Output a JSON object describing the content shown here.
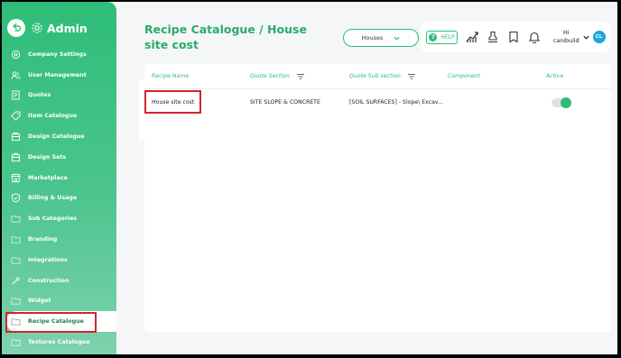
{
  "sidebar": {
    "title": "Admin",
    "items": [
      {
        "label": "Company Settings",
        "icon": "company-settings-icon"
      },
      {
        "label": "User Management",
        "icon": "users-icon"
      },
      {
        "label": "Quotes",
        "icon": "quotes-icon"
      },
      {
        "label": "Item Catalogue",
        "icon": "tag-icon"
      },
      {
        "label": "Design Catalogue",
        "icon": "design-catalogue-icon"
      },
      {
        "label": "Design Sets",
        "icon": "design-sets-icon"
      },
      {
        "label": "Marketplace",
        "icon": "marketplace-icon"
      },
      {
        "label": "Billing & Usage",
        "icon": "shield-check-icon"
      },
      {
        "label": "Sub Categories",
        "icon": "folder-icon"
      },
      {
        "label": "Branding",
        "icon": "folder-icon"
      },
      {
        "label": "Integrations",
        "icon": "folder-icon"
      },
      {
        "label": "Construction",
        "icon": "construction-icon"
      },
      {
        "label": "Widget",
        "icon": "folder-icon"
      },
      {
        "label": "Recipe Catalogue",
        "icon": "folder-icon",
        "active": true
      },
      {
        "label": "Textures Catalogue",
        "icon": "folder-icon"
      }
    ]
  },
  "header": {
    "title": "Recipe Catalogue / House site cost",
    "dropdown_value": "Houses",
    "help_label": "HELP",
    "greeting": "Hi",
    "username": "canibuild",
    "avatar_initials": "CL"
  },
  "table": {
    "columns": [
      "Recipe Name",
      "Quote Section",
      "Quote Sub section",
      "Component",
      "Active"
    ],
    "rows": [
      {
        "name": "House site cost",
        "section": "SITE SLOPE & CONCRETE",
        "subsection": "[SOIL SURFACES] - Slope\\ Excav...",
        "component": "",
        "active": true
      }
    ]
  },
  "colors": {
    "accent": "#2ebd78",
    "highlight": "#d4242a",
    "avatar": "#1ea6d8"
  }
}
